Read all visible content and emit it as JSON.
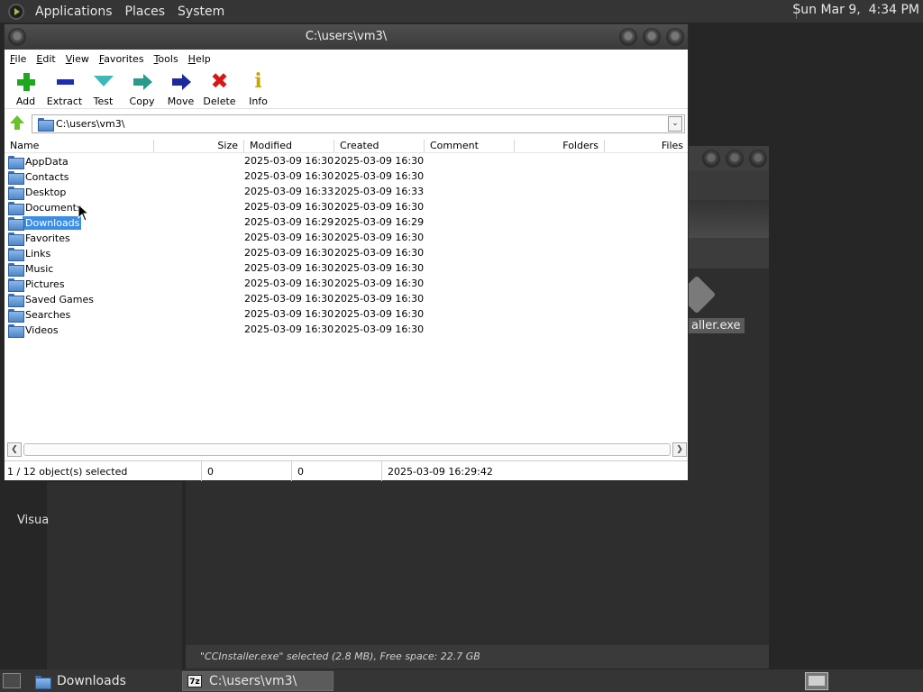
{
  "top_panel": {
    "menus": [
      "Applications",
      "Places",
      "System"
    ],
    "clock": "Sun Mar 9,  4:34 PM"
  },
  "background": {
    "side_label": "Visua",
    "file_label": "aller.exe",
    "status": "\"CCInstaller.exe\" selected (2.8 MB), Free space: 22.7 GB"
  },
  "window": {
    "title": "C:\\users\\vm3\\",
    "menu": [
      "File",
      "Edit",
      "View",
      "Favorites",
      "Tools",
      "Help"
    ],
    "toolbar": [
      {
        "label": "Add",
        "icon": "add-icon"
      },
      {
        "label": "Extract",
        "icon": "extract-icon"
      },
      {
        "label": "Test",
        "icon": "test-icon"
      },
      {
        "label": "Copy",
        "icon": "copy-icon"
      },
      {
        "label": "Move",
        "icon": "move-icon"
      },
      {
        "label": "Delete",
        "icon": "delete-icon"
      },
      {
        "label": "Info",
        "icon": "info-icon"
      }
    ],
    "address": "C:\\users\\vm3\\",
    "columns": [
      "Name",
      "Size",
      "Modified",
      "Created",
      "Comment",
      "Folders",
      "Files"
    ],
    "rows": [
      {
        "name": "AppData",
        "modified": "2025-03-09 16:30",
        "created": "2025-03-09 16:30"
      },
      {
        "name": "Contacts",
        "modified": "2025-03-09 16:30",
        "created": "2025-03-09 16:30"
      },
      {
        "name": "Desktop",
        "modified": "2025-03-09 16:33",
        "created": "2025-03-09 16:33"
      },
      {
        "name": "Documents",
        "modified": "2025-03-09 16:30",
        "created": "2025-03-09 16:30"
      },
      {
        "name": "Downloads",
        "modified": "2025-03-09 16:29",
        "created": "2025-03-09 16:29",
        "selected": true
      },
      {
        "name": "Favorites",
        "modified": "2025-03-09 16:30",
        "created": "2025-03-09 16:30"
      },
      {
        "name": "Links",
        "modified": "2025-03-09 16:30",
        "created": "2025-03-09 16:30"
      },
      {
        "name": "Music",
        "modified": "2025-03-09 16:30",
        "created": "2025-03-09 16:30"
      },
      {
        "name": "Pictures",
        "modified": "2025-03-09 16:30",
        "created": "2025-03-09 16:30"
      },
      {
        "name": "Saved Games",
        "modified": "2025-03-09 16:30",
        "created": "2025-03-09 16:30"
      },
      {
        "name": "Searches",
        "modified": "2025-03-09 16:30",
        "created": "2025-03-09 16:30"
      },
      {
        "name": "Videos",
        "modified": "2025-03-09 16:30",
        "created": "2025-03-09 16:30"
      }
    ],
    "status": {
      "selection": "1 / 12 object(s) selected",
      "size": "0",
      "packed": "0",
      "modified": "2025-03-09 16:29:42"
    }
  },
  "taskbar": {
    "tasks": [
      "Downloads",
      "C:\\users\\vm3\\"
    ],
    "zip_icon_text": "7z"
  }
}
